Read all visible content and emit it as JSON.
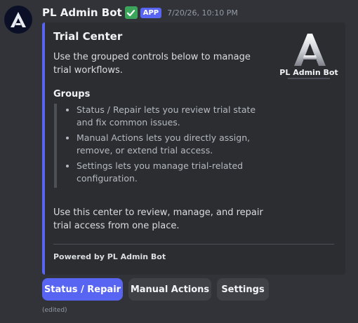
{
  "message": {
    "author": "PL Admin Bot",
    "verified_icon": "check-mark-icon",
    "app_badge": "APP",
    "timestamp": "7/20/26, 10:10 PM",
    "edited_label": "(edited)"
  },
  "embed": {
    "accent_color": "#5865f2",
    "title": "Trial Center",
    "description": "Use the grouped controls below to manage trial workflows.",
    "thumbnail": {
      "logo_letter": "A",
      "name": "PL Admin Bot"
    },
    "field": {
      "name": "Groups",
      "items": [
        "Status / Repair lets you review trial state and fix common issues.",
        "Manual Actions lets you directly assign, remove, or extend trial access.",
        "Settings lets you manage trial-related configuration."
      ]
    },
    "closing": "Use this center to review, manage, and repair trial access from one place.",
    "footer": "Powered by PL Admin Bot"
  },
  "buttons": {
    "status_repair": "Status / Repair",
    "manual_actions": "Manual Actions",
    "settings": "Settings"
  }
}
